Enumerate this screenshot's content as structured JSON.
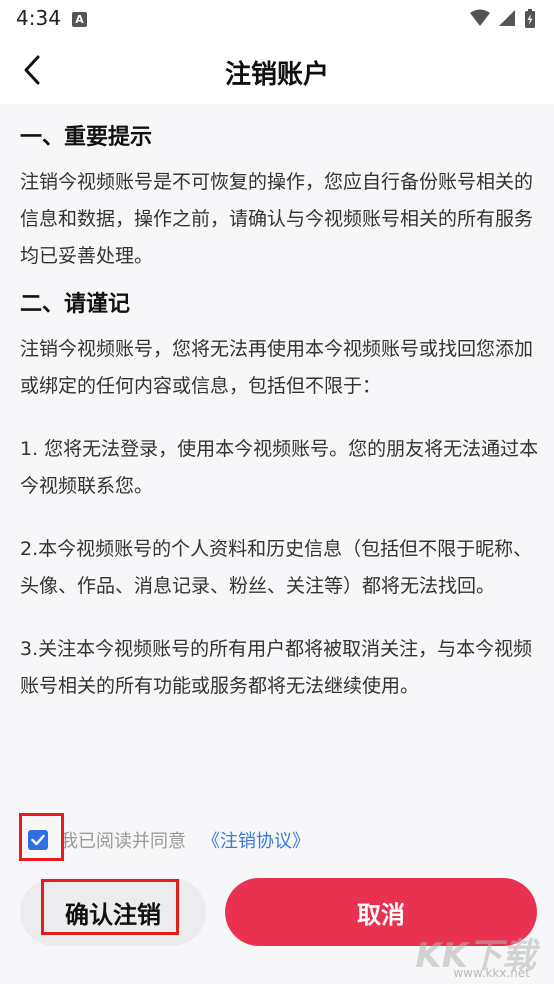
{
  "status": {
    "time": "4:34",
    "notif_label": "A"
  },
  "header": {
    "title": "注销账户"
  },
  "sections": [
    {
      "title": "一、重要提示",
      "paras": [
        "注销今视频账号是不可恢复的操作，您应自行备份账号相关的信息和数据，操作之前，请确认与今视频账号相关的所有服务均已妥善处理。"
      ]
    },
    {
      "title": "二、请谨记",
      "paras": [
        "注销今视频账号，您将无法再使用本今视频账号或找回您添加或绑定的任何内容或信息，包括但不限于：",
        "1. 您将无法登录，使用本今视频账号。您的朋友将无法通过本今视频联系您。",
        "2.本今视频账号的个人资料和历史信息（包括但不限于昵称、头像、作品、消息记录、粉丝、关注等）都将无法找回。",
        "3.关注本今视频账号的所有用户都将被取消关注，与本今视频账号相关的所有功能或服务都将无法继续使用。"
      ]
    }
  ],
  "agreement": {
    "checked": true,
    "text": "我已阅读并同意",
    "link": "《注销协议》"
  },
  "buttons": {
    "confirm": "确认注销",
    "cancel": "取消"
  },
  "watermark": {
    "main": "KK下载",
    "sub": "www.kkx.net"
  },
  "colors": {
    "accent": "#e8324f",
    "link": "#3a7bd5",
    "checkbox": "#2f6fe0",
    "highlight": "#e41e1e"
  }
}
